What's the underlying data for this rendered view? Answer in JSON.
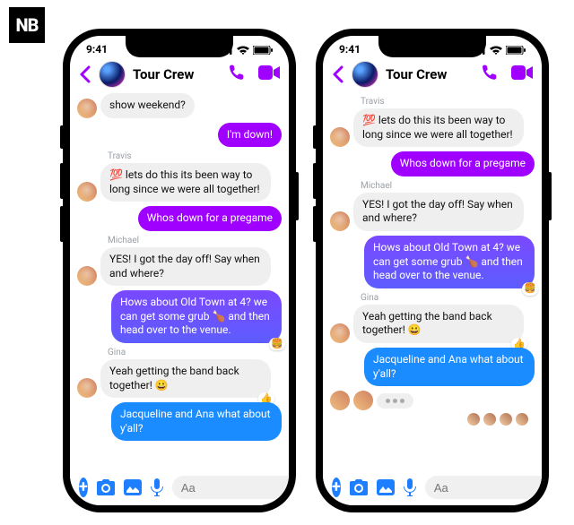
{
  "logo_text": "NB",
  "status_time": "9:41",
  "header": {
    "title": "Tour Crew"
  },
  "composer": {
    "placeholder": "Aa"
  },
  "phone_a": {
    "messages": {
      "cutoff": "show weekend?",
      "m1": "I'm down!",
      "s1": "Travis",
      "m2": "💯 lets do this its been way to long since we were all together!",
      "m3": "Whos down for a pregame",
      "s2": "Michael",
      "m4": "YES! I got the day off! Say when and where?",
      "m5": "Hows about Old Town at 4? we can get some grub 🍗 and then head over to the venue.",
      "r5": "🍔",
      "s3": "Gina",
      "m6": "Yeah getting the band back together! 😀",
      "r6": "👍",
      "m7": "Jacqueline and Ana what about y'all?"
    }
  },
  "phone_b": {
    "messages": {
      "s1": "Travis",
      "m1": "💯 lets do this its been way to long since we were all together!",
      "m2": "Whos down for a pregame",
      "s2": "Michael",
      "m3": "YES! I got the day off! Say when and where?",
      "m4": "Hows about Old Town at 4? we can get some grub 🍗 and then head over to the venue.",
      "r4": "🍔",
      "s3": "Gina",
      "m5": "Yeah getting the band back together! 😀",
      "r5": "👍",
      "m6": "Jacqueline and Ana what about y'all?"
    }
  }
}
